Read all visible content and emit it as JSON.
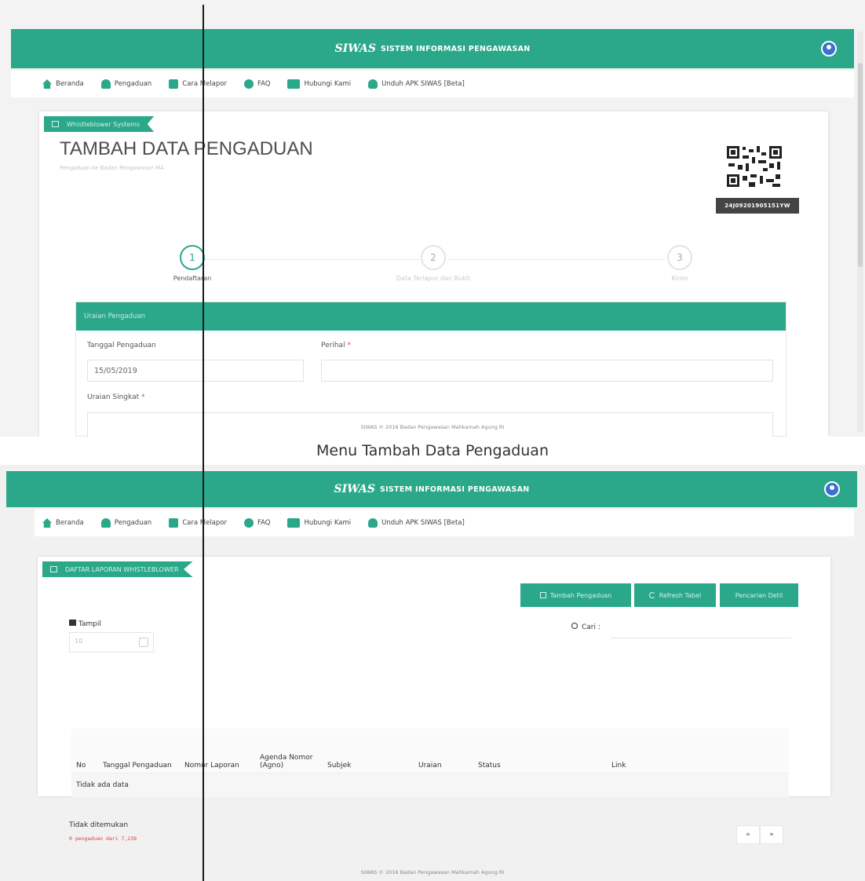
{
  "brand": {
    "logo": "SIWAS",
    "title": "SISTEM INFORMASI PENGAWASAN",
    "color": "#2aa889"
  },
  "nav": {
    "items": [
      {
        "label": "Beranda",
        "icon": "home-icon",
        "color": "#2aa889"
      },
      {
        "label": "Pengaduan",
        "icon": "users-icon",
        "color": "#2aa889"
      },
      {
        "label": "Cara Melapor",
        "icon": "book-icon",
        "color": "#2aa889"
      },
      {
        "label": "FAQ",
        "icon": "question-icon",
        "color": "#2aa889"
      },
      {
        "label": "Hubungi Kami",
        "icon": "mail-icon",
        "color": "#2aa889"
      },
      {
        "label": "Unduh APK SIWAS [Beta]",
        "icon": "android-icon",
        "color": "#2aa889"
      }
    ]
  },
  "top": {
    "ribbon": "Whistleblower Systems",
    "title": "TAMBAH DATA PENGADUAN",
    "subtitle": "Pengaduan ke Badan Pengawasan MA",
    "qr_code": "24J09201905151YW",
    "steps": [
      {
        "number": "1",
        "label": "Pendaftaran",
        "active": true
      },
      {
        "number": "2",
        "label": "Data Terlapor dan Bukti",
        "active": false
      },
      {
        "number": "3",
        "label": "Kirim",
        "active": false
      }
    ],
    "form": {
      "header": "Uraian Pengaduan",
      "tanggal_label": "Tanggal Pengaduan",
      "tanggal_value": "15/05/2019",
      "perihal_label": "Perihal",
      "uraian_label": "Uraian Singkat",
      "required_mark": "*"
    },
    "footer": "SIWAS © 2016 Badan Pengawasan Mahkamah Agung RI"
  },
  "caption": "Menu Tambah Data Pengaduan",
  "bottom": {
    "ribbon": "DAFTAR LAPORAN WHISTLEBLOWER",
    "buttons": [
      {
        "label": "Tambah Pengaduan",
        "icon": "edit-icon"
      },
      {
        "label": "Refresh Tabel",
        "icon": "refresh-icon"
      },
      {
        "label": "Pencarian Detil",
        "icon": ""
      }
    ],
    "show_label": "Tampil",
    "show_value": "10",
    "search_label": "Cari :",
    "columns": [
      "No",
      "Tanggal Pengaduan",
      "Nomor Laporan",
      "Agenda Nomor (Agno)",
      "Subjek",
      "Uraian",
      "Status",
      "Link"
    ],
    "empty_row": "Tidak ada data",
    "info": "Tidak ditemukan",
    "count_note": "0 pengaduan dari 7,239",
    "pager": [
      "«",
      "»"
    ],
    "footer": "SIWAS © 2016 Badan Pengawasan Mahkamah Agung RI"
  }
}
